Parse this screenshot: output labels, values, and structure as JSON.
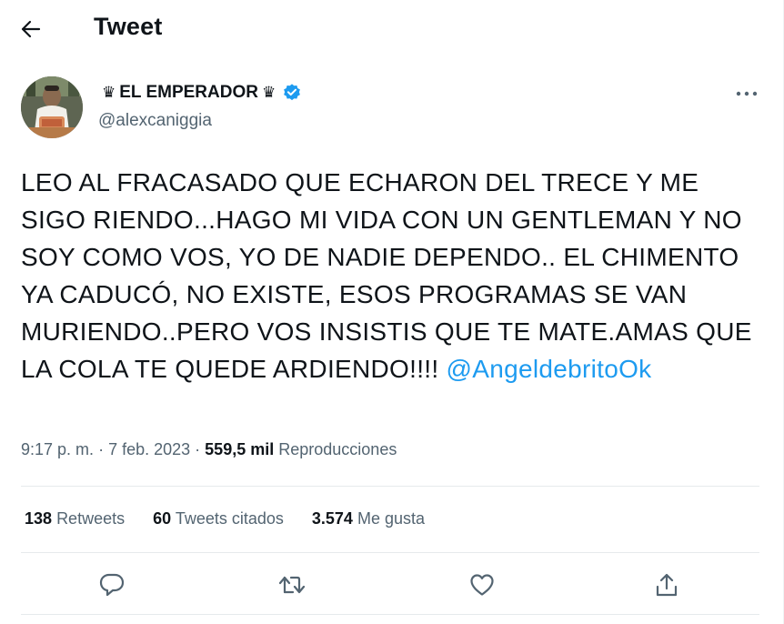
{
  "header": {
    "title": "Tweet"
  },
  "author": {
    "display_name": "EL EMPERADOR",
    "crown_left": "♛",
    "crown_right": "♛",
    "handle": "@alexcaniggia",
    "verified": true
  },
  "tweet": {
    "text": "LEO AL FRACASADO QUE ECHARON DEL TRECE Y ME SIGO RIENDO...HAGO MI VIDA CON UN GENTLEMAN Y NO SOY COMO VOS, YO DE NADIE DEPENDO.. EL CHIMENTO YA CADUCÓ, NO EXISTE, ESOS PROGRAMAS SE VAN MURIENDO..PERO VOS INSISTIS QUE TE MATE.AMAS QUE LA COLA TE QUEDE ARDIENDO!!!!",
    "mention": "@AngeldebritoOk",
    "time": "9:17 p. m.",
    "date": "7 feb. 2023",
    "views_count": "559,5 mil",
    "views_label": "Reproducciones"
  },
  "stats": {
    "retweets_count": "138",
    "retweets_label": "Retweets",
    "quotes_count": "60",
    "quotes_label": "Tweets citados",
    "likes_count": "3.574",
    "likes_label": "Me gusta"
  },
  "icons": {
    "back": "back-arrow-icon",
    "more": "more-dots-icon",
    "verified": "verified-badge-icon",
    "reply": "reply-icon",
    "retweet": "retweet-icon",
    "like": "like-icon",
    "share": "share-icon"
  },
  "colors": {
    "accent": "#1d9bf0",
    "text": "#0f1419",
    "secondary": "#536471",
    "divider": "#e6eaec"
  }
}
